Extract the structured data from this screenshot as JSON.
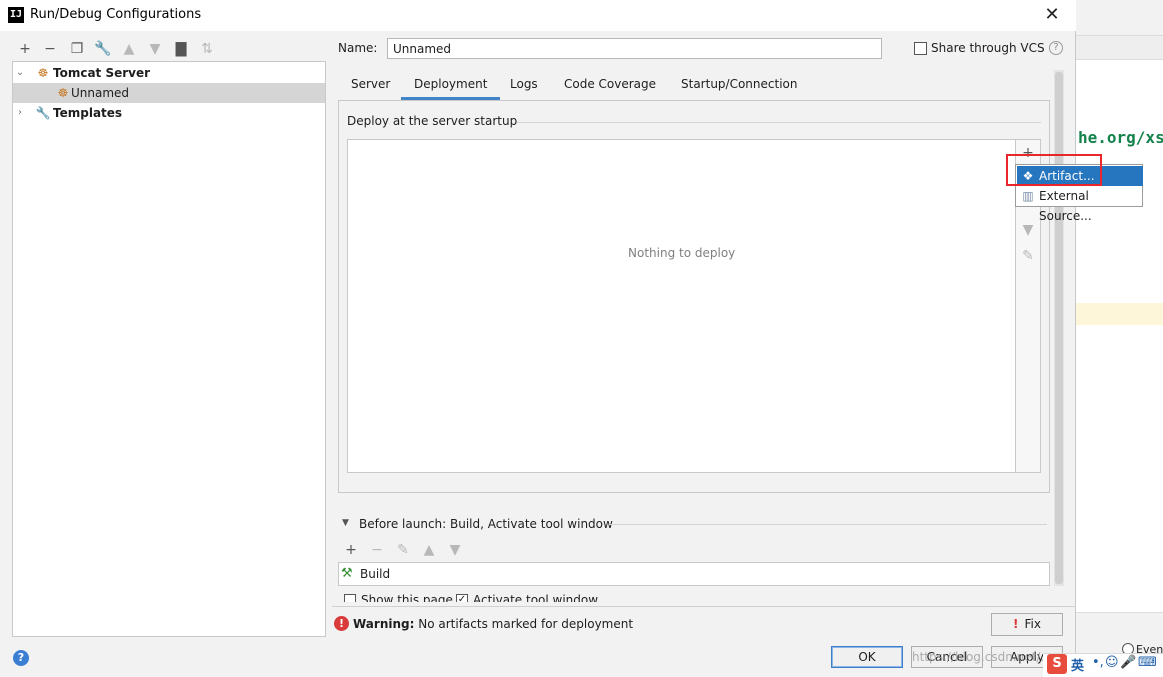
{
  "window": {
    "title": "Run/Debug Configurations",
    "close": "✕",
    "app_icon_text": "IJ"
  },
  "left_toolbar": {
    "icons": [
      "add-icon",
      "remove-icon",
      "copy-icon",
      "wrench-icon",
      "arrow-up-icon",
      "arrow-down-icon",
      "folder-add-icon",
      "sort-icon"
    ]
  },
  "tree": {
    "items": [
      {
        "label": "Tomcat Server",
        "expanded": true
      },
      {
        "label": "Unnamed",
        "selected": true
      },
      {
        "label": "Templates",
        "expanded": false
      }
    ]
  },
  "name_field": {
    "label": "Name:",
    "value": "Unnamed"
  },
  "share": {
    "label": "Share through VCS",
    "checked": false,
    "help": "?"
  },
  "tabs": [
    {
      "label": "Server"
    },
    {
      "label": "Deployment",
      "active": true
    },
    {
      "label": "Logs"
    },
    {
      "label": "Code Coverage"
    },
    {
      "label": "Startup/Connection"
    }
  ],
  "deployment": {
    "group_title": "Deploy at the server startup",
    "empty_text": "Nothing to deploy",
    "side_icons": [
      "add-icon",
      "arrow-down-icon",
      "pencil-icon"
    ]
  },
  "add_popup": {
    "items": [
      {
        "label": "Artifact...",
        "icon": "artifact-icon",
        "highlighted": true
      },
      {
        "label": "External Source...",
        "icon": "external-source-icon"
      }
    ]
  },
  "before_launch": {
    "label": "Before launch: Build, Activate tool window",
    "tasks": [
      {
        "label": "Build",
        "icon": "hammer-icon"
      }
    ],
    "show_page_label": "Show this page",
    "activate_label": "Activate tool window"
  },
  "warning": {
    "title": "Warning:",
    "message": "No artifacts marked for deployment"
  },
  "buttons": {
    "fix": "Fix",
    "ok": "OK",
    "cancel": "Cancel",
    "apply": "Apply",
    "help": "?"
  },
  "background": {
    "code_fragment": "he.org/xs",
    "radio_label": "Even"
  },
  "watermark": "https://blog.csdn.net/...",
  "colors": {
    "accent": "#2675bf",
    "tab_underline": "#4083c9",
    "highlight_box": "#e8262b",
    "warning": "#d93b3b"
  }
}
